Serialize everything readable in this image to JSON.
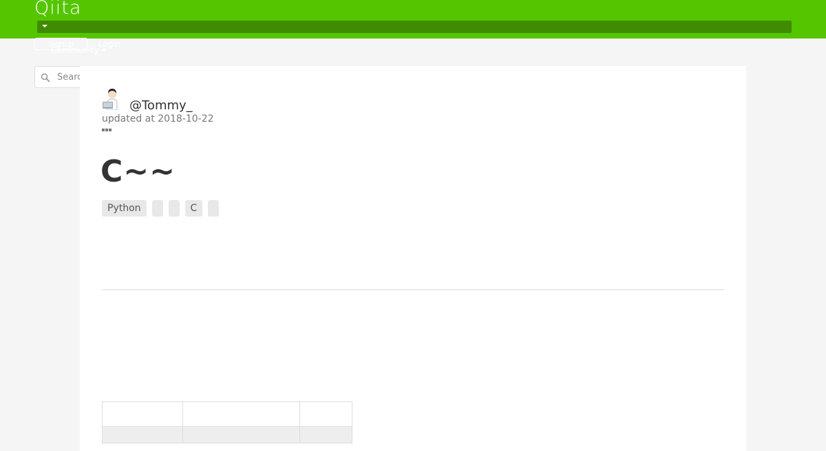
{
  "header": {
    "logo": "Qiita",
    "signup_label": "Signup",
    "login_label": "Login",
    "community_label": "Community",
    "caret_icon": "caret-down-icon"
  },
  "search": {
    "placeholder": "Search",
    "icon": "search-icon"
  },
  "article": {
    "author": "@Tommy_",
    "updated": "updated at 2018-10-22",
    "title": "C~~",
    "tags": [
      "Python",
      "",
      "",
      "C",
      ""
    ],
    "table": {
      "headers": [
        "",
        "",
        ""
      ],
      "rows": [
        [
          "",
          "",
          ""
        ]
      ]
    }
  },
  "colors": {
    "brand": "#55c500",
    "brand_dark": "#3f8c00",
    "background": "#f5f5f5"
  }
}
